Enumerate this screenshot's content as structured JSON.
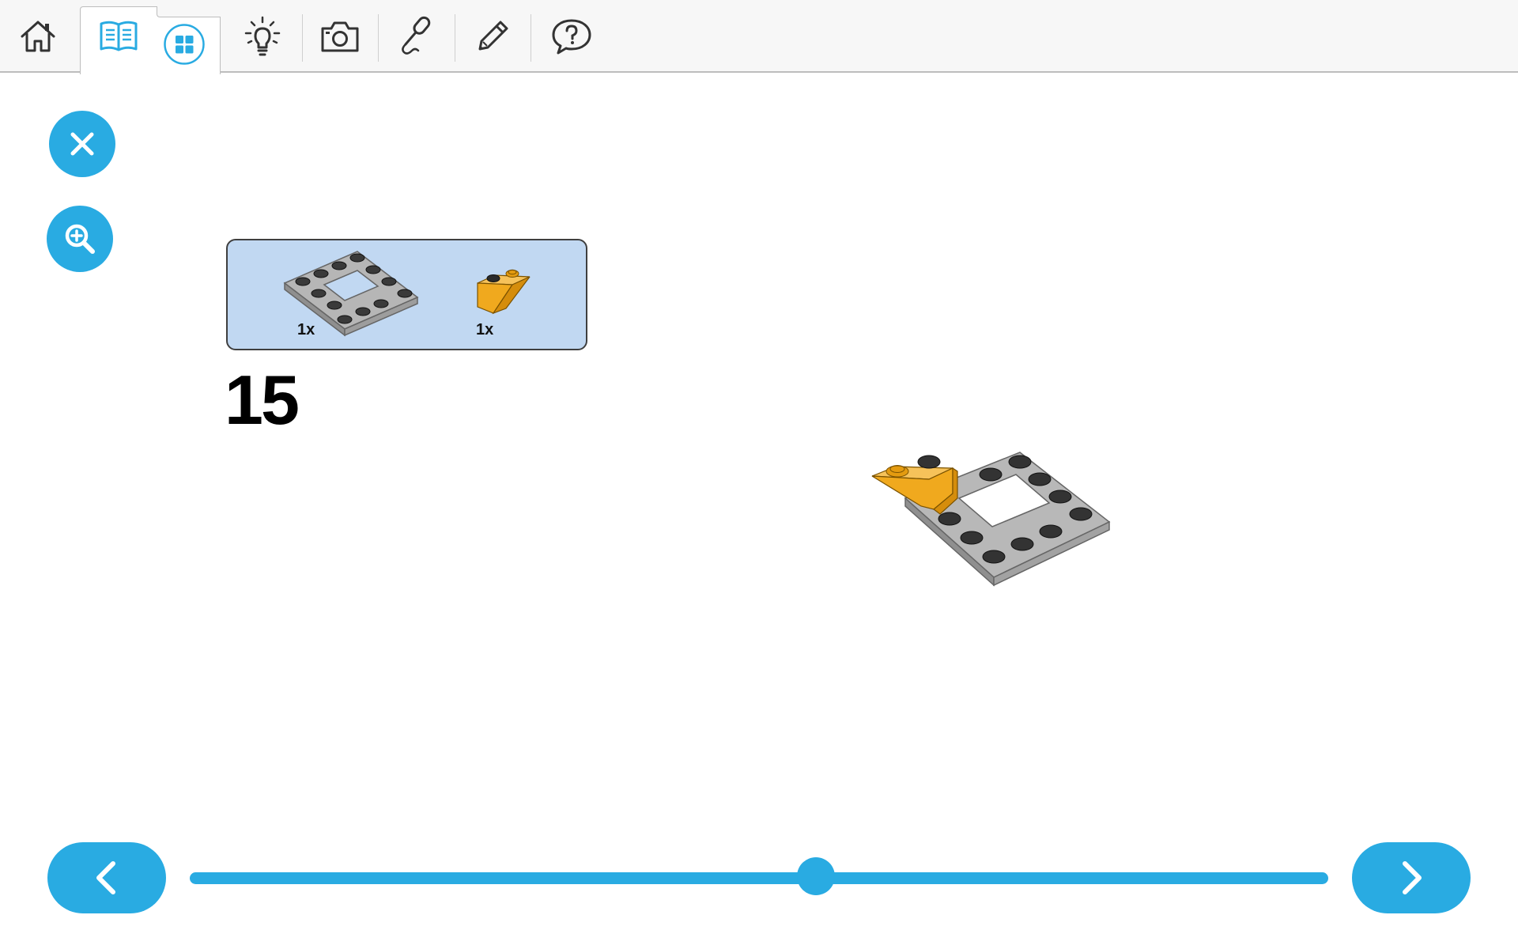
{
  "toolbar": {
    "items": [
      {
        "id": "home",
        "icon": "home-icon"
      },
      {
        "id": "instructions",
        "icon": "book-icon",
        "active": true
      },
      {
        "id": "grid",
        "icon": "grid-icon"
      },
      {
        "id": "ideas",
        "icon": "lightbulb-icon"
      },
      {
        "id": "camera",
        "icon": "camera-icon"
      },
      {
        "id": "record",
        "icon": "microphone-icon"
      },
      {
        "id": "notes",
        "icon": "pencil-icon"
      },
      {
        "id": "help",
        "icon": "help-bubble-icon"
      }
    ]
  },
  "side_buttons": {
    "close_icon": "close-icon",
    "zoom_icon": "zoom-in-icon"
  },
  "parts": [
    {
      "name": "frame-plate",
      "count_label": "1x"
    },
    {
      "name": "orange-inverted-slope",
      "count_label": "1x"
    }
  ],
  "step": {
    "number": "15"
  },
  "navigation": {
    "prev_icon": "chevron-left-icon",
    "next_icon": "chevron-right-icon",
    "progress": 0.55
  },
  "colors": {
    "accent": "#29abe2",
    "parts_box_bg": "#c1d8f2",
    "brick_gray": "#a9a9a9",
    "brick_orange": "#f0a91e",
    "stud_dark": "#2b2b2b"
  }
}
